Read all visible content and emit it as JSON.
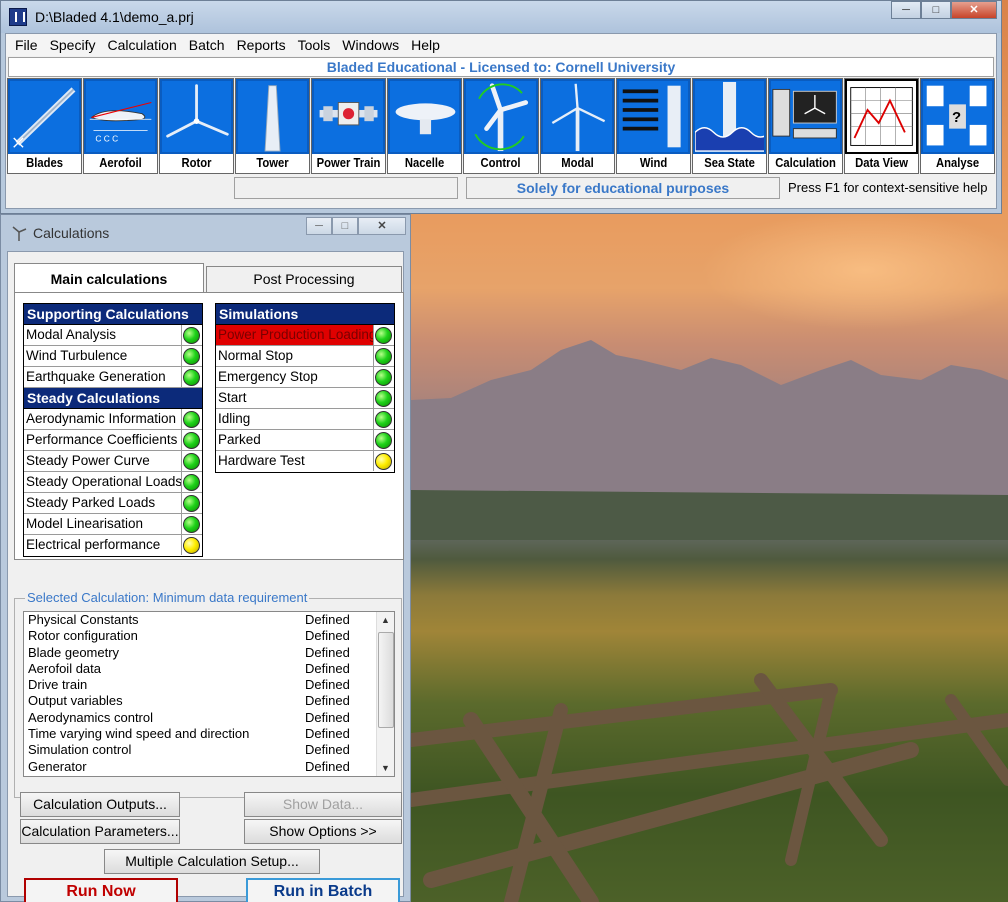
{
  "main_window": {
    "title": "D:\\Bladed 4.1\\demo_a.prj",
    "menu": [
      "File",
      "Specify",
      "Calculation",
      "Batch",
      "Reports",
      "Tools",
      "Windows",
      "Help"
    ],
    "license": "Bladed Educational - Licensed to: Cornell University",
    "toolbar": [
      {
        "label": "Blades",
        "icon": "blade-icon"
      },
      {
        "label": "Aerofoil",
        "icon": "aerofoil-icon"
      },
      {
        "label": "Rotor",
        "icon": "rotor-icon"
      },
      {
        "label": "Tower",
        "icon": "tower-icon"
      },
      {
        "label": "Power Train",
        "icon": "power-train-icon"
      },
      {
        "label": "Nacelle",
        "icon": "nacelle-icon"
      },
      {
        "label": "Control",
        "icon": "control-icon"
      },
      {
        "label": "Modal",
        "icon": "modal-icon"
      },
      {
        "label": "Wind",
        "icon": "wind-icon"
      },
      {
        "label": "Sea State",
        "icon": "sea-state-icon"
      },
      {
        "label": "Calculation",
        "icon": "calculation-icon"
      },
      {
        "label": "Data View",
        "icon": "data-view-icon"
      },
      {
        "label": "Analyse",
        "icon": "analyse-icon"
      }
    ],
    "status_edu": "Solely for educational purposes",
    "status_help": "Press F1 for context-sensitive help"
  },
  "calc_window": {
    "title": "Calculations",
    "tabs": [
      "Main calculations",
      "Post Processing"
    ],
    "supporting_header": "Supporting Calculations",
    "supporting": [
      {
        "label": "Modal Analysis",
        "status": "green"
      },
      {
        "label": "Wind Turbulence",
        "status": "green"
      },
      {
        "label": "Earthquake Generation",
        "status": "green"
      }
    ],
    "steady_header": "Steady Calculations",
    "steady": [
      {
        "label": "Aerodynamic Information",
        "status": "green"
      },
      {
        "label": "Performance Coefficients",
        "status": "green"
      },
      {
        "label": "Steady Power Curve",
        "status": "green"
      },
      {
        "label": "Steady Operational Loads",
        "status": "green"
      },
      {
        "label": "Steady Parked Loads",
        "status": "green"
      },
      {
        "label": "Model Linearisation",
        "status": "green"
      },
      {
        "label": "Electrical performance",
        "status": "yellow"
      }
    ],
    "simulations_header": "Simulations",
    "simulations": [
      {
        "label": "Power Production Loading",
        "status": "green",
        "selected": true
      },
      {
        "label": "Normal Stop",
        "status": "green"
      },
      {
        "label": "Emergency Stop",
        "status": "green"
      },
      {
        "label": "Start",
        "status": "green"
      },
      {
        "label": "Idling",
        "status": "green"
      },
      {
        "label": "Parked",
        "status": "green"
      },
      {
        "label": "Hardware Test",
        "status": "yellow"
      }
    ],
    "selected_title": "Selected Calculation: Minimum data requirement",
    "requirements": [
      {
        "item": "Physical Constants",
        "state": "Defined"
      },
      {
        "item": "Rotor configuration",
        "state": "Defined"
      },
      {
        "item": "Blade geometry",
        "state": "Defined"
      },
      {
        "item": "Aerofoil data",
        "state": "Defined"
      },
      {
        "item": "Drive train",
        "state": "Defined"
      },
      {
        "item": "Output variables",
        "state": "Defined"
      },
      {
        "item": "Aerodynamics control",
        "state": "Defined"
      },
      {
        "item": "Time varying wind speed and direction",
        "state": "Defined"
      },
      {
        "item": "Simulation control",
        "state": "Defined"
      },
      {
        "item": "Generator",
        "state": "Defined"
      }
    ],
    "buttons": {
      "outputs": "Calculation Outputs...",
      "show_data": "Show Data...",
      "parameters": "Calculation Parameters...",
      "show_options": "Show Options >>",
      "multiple": "Multiple Calculation Setup...",
      "run_now": "Run Now",
      "run_batch": "Run in Batch"
    }
  },
  "colors": {
    "toolbar_blue": "#0c6fe0",
    "list_header": "#0c2a7a",
    "selected_row": "#e00000",
    "accent_text": "#3a78c8"
  }
}
